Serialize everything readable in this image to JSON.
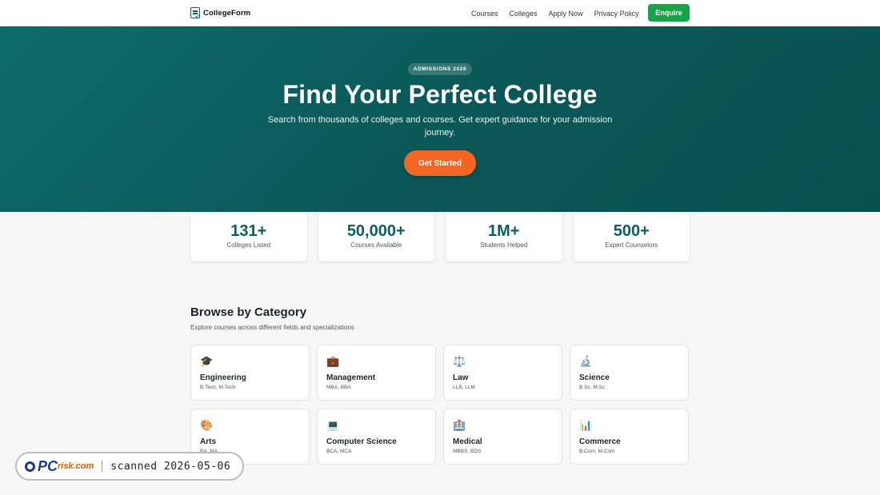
{
  "header": {
    "brand": "CollegeForm",
    "nav": [
      "Courses",
      "Colleges",
      "Apply Now",
      "Privacy Policy"
    ],
    "cta": "Enquire"
  },
  "hero": {
    "badge": "ADMISSIONS 2026",
    "title": "Find Your Perfect College",
    "subtitle": "Search from thousands of colleges and courses. Get expert guidance for your admission journey.",
    "cta": "Get Started"
  },
  "stats": [
    {
      "value": "131+",
      "label": "Colleges Listed"
    },
    {
      "value": "50,000+",
      "label": "Courses Available"
    },
    {
      "value": "1M+",
      "label": "Students Helped"
    },
    {
      "value": "500+",
      "label": "Expert Counselors"
    }
  ],
  "categories": {
    "title": "Browse by Category",
    "subtitle": "Explore courses across different fields and specializations",
    "items": [
      {
        "icon": "🎓",
        "name": "Engineering",
        "sub": "B.Tech, M.Tech"
      },
      {
        "icon": "💼",
        "name": "Management",
        "sub": "MBA, BBA"
      },
      {
        "icon": "⚖️",
        "name": "Law",
        "sub": "LLB, LLM"
      },
      {
        "icon": "🔬",
        "name": "Science",
        "sub": "B.Sc, M.Sc"
      },
      {
        "icon": "🎨",
        "name": "Arts",
        "sub": "BA, MA"
      },
      {
        "icon": "💻",
        "name": "Computer Science",
        "sub": "BCA, MCA"
      },
      {
        "icon": "🏥",
        "name": "Medical",
        "sub": "MBBS, BDS"
      },
      {
        "icon": "📊",
        "name": "Commerce",
        "sub": "B.Com, M.Com"
      }
    ]
  },
  "watermark": {
    "logo_main": "PC",
    "logo_small": "risk.com",
    "text": "scanned 2026-05-06"
  },
  "colors": {
    "primary": "#0d6b6b",
    "accent": "#f26522",
    "success": "#16a34a"
  }
}
